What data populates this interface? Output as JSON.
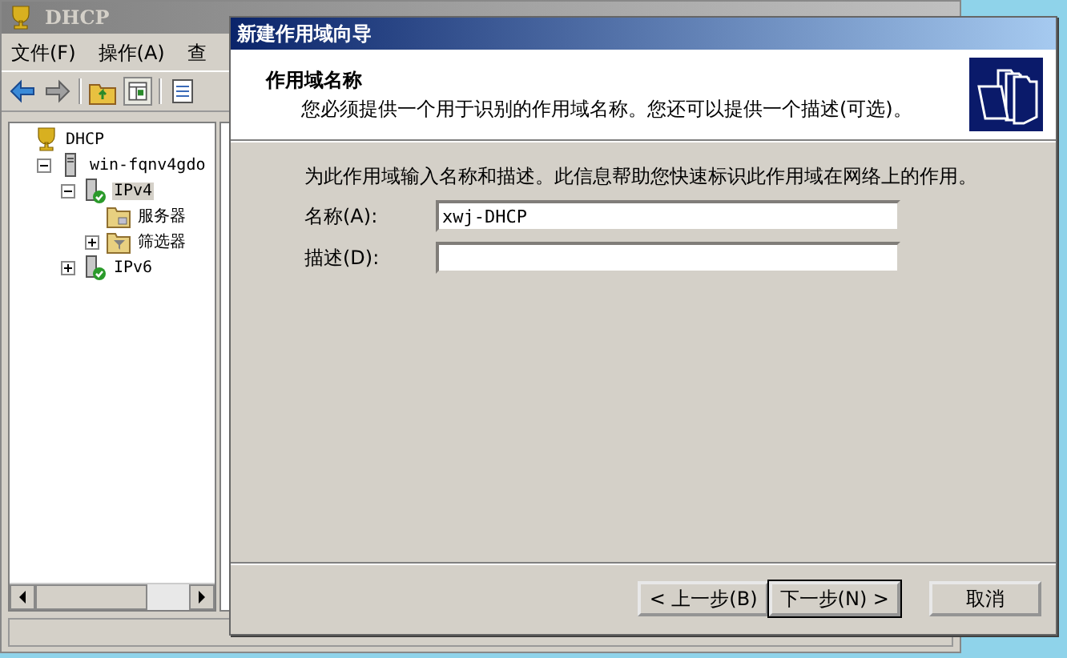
{
  "main_window": {
    "title": "DHCP",
    "menu": [
      "文件(F)",
      "操作(A)",
      "查"
    ],
    "tree": [
      {
        "label": "DHCP",
        "kind": "root",
        "selected": false,
        "children": [
          {
            "label": "win-fqnv4gdo",
            "kind": "server",
            "selected": false,
            "expanded": true,
            "children": [
              {
                "label": "IPv4",
                "kind": "protocol",
                "selected": true,
                "expanded": true,
                "children": [
                  {
                    "label": "服务器",
                    "kind": "folder",
                    "selected": false
                  },
                  {
                    "label": "筛选器",
                    "kind": "filter",
                    "selected": false,
                    "expanded": false
                  }
                ]
              },
              {
                "label": "IPv6",
                "kind": "protocol",
                "selected": false,
                "expanded": false
              }
            ]
          }
        ]
      }
    ]
  },
  "dialog": {
    "title": "新建作用域向导",
    "header": {
      "title": "作用域名称",
      "subtitle": "您必须提供一个用于识别的作用域名称。您还可以提供一个描述(可选)。"
    },
    "intro": "为此作用域输入名称和描述。此信息帮助您快速标识此作用域在网络上的作用。",
    "fields": [
      {
        "label": "名称(A):",
        "value": "xwj-DHCP"
      },
      {
        "label": "描述(D):"
      }
    ],
    "buttons": [
      {
        "label": "< 上一步(B)",
        "default": false
      },
      {
        "label": "下一步(N) >",
        "default": true
      },
      {
        "label": "取消",
        "default": false
      }
    ]
  }
}
